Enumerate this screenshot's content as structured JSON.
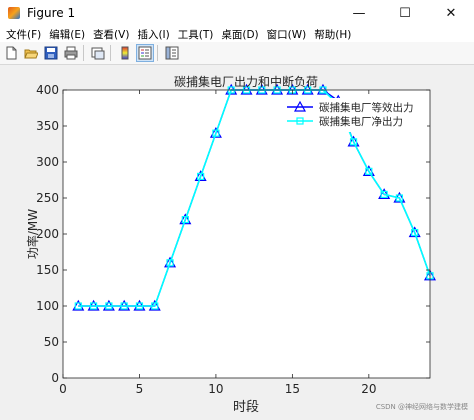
{
  "window": {
    "title": "Figure 1",
    "controls": [
      "—",
      "☐",
      "✕"
    ]
  },
  "menu": {
    "items": [
      "文件(F)",
      "编辑(E)",
      "查看(V)",
      "插入(I)",
      "工具(T)",
      "桌面(D)",
      "窗口(W)",
      "帮助(H)"
    ]
  },
  "toolbar": {
    "icons": [
      "new-figure-icon",
      "open-file-icon",
      "save-icon",
      "print-icon",
      "link-plot-icon",
      "insert-colorbar-icon",
      "insert-legend-icon",
      "property-editor-icon"
    ]
  },
  "chart_data": {
    "type": "line",
    "title": "碳捕集电厂出力和中断负荷",
    "xlabel": "时段",
    "ylabel": "功率/MW",
    "xlim": [
      0,
      24
    ],
    "ylim": [
      0,
      400
    ],
    "xticks": [
      0,
      5,
      10,
      15,
      20
    ],
    "yticks": [
      0,
      50,
      100,
      150,
      200,
      250,
      300,
      350,
      400
    ],
    "x": [
      1,
      2,
      3,
      4,
      5,
      6,
      7,
      8,
      9,
      10,
      11,
      12,
      13,
      14,
      15,
      16,
      17,
      18,
      19,
      20,
      21,
      22,
      23,
      24
    ],
    "series": [
      {
        "name": "碳捕集电厂等效出力",
        "color": "#0000ff",
        "marker": "triangle",
        "values": [
          100,
          100,
          100,
          100,
          100,
          100,
          160,
          220,
          280,
          340,
          400,
          400,
          400,
          400,
          400,
          400,
          400,
          385,
          328,
          287,
          255,
          250,
          202,
          142
        ]
      },
      {
        "name": "碳捕集电厂净出力",
        "color": "#00ffff",
        "marker": "square",
        "values": [
          100,
          100,
          100,
          100,
          100,
          100,
          160,
          220,
          280,
          340,
          400,
          400,
          400,
          400,
          400,
          400,
          400,
          380,
          328,
          287,
          255,
          250,
          202,
          142
        ]
      }
    ],
    "legend_position": "top-right",
    "grid": false
  },
  "watermark": "CSDN @神经网络与数学建模"
}
